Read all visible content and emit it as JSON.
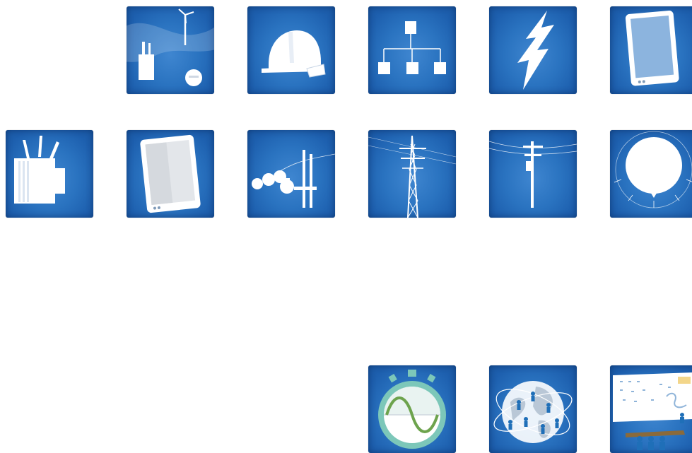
{
  "icons": [
    {
      "name": "renewable-grid-icon"
    },
    {
      "name": "hard-hat-icon"
    },
    {
      "name": "hierarchy-icon"
    },
    {
      "name": "lightning-bolt-icon"
    },
    {
      "name": "tablet-icon"
    },
    {
      "name": "transformer-icon"
    },
    {
      "name": "tablet-screen-icon"
    },
    {
      "name": "insulators-icon"
    },
    {
      "name": "transmission-tower-icon"
    },
    {
      "name": "utility-pole-icon"
    },
    {
      "name": "light-bulb-icon"
    },
    {
      "name": "stopwatch-waveform-icon"
    },
    {
      "name": "global-network-icon"
    },
    {
      "name": "control-room-icon"
    }
  ],
  "colors": {
    "tile_blue": "#2a73c0",
    "icon_white": "#ffffff",
    "stopwatch_teal": "#7cc7b9",
    "wave_green": "#6da34d",
    "person_blue": "#1f6fb8",
    "desk_brown": "#8a6a3a"
  }
}
